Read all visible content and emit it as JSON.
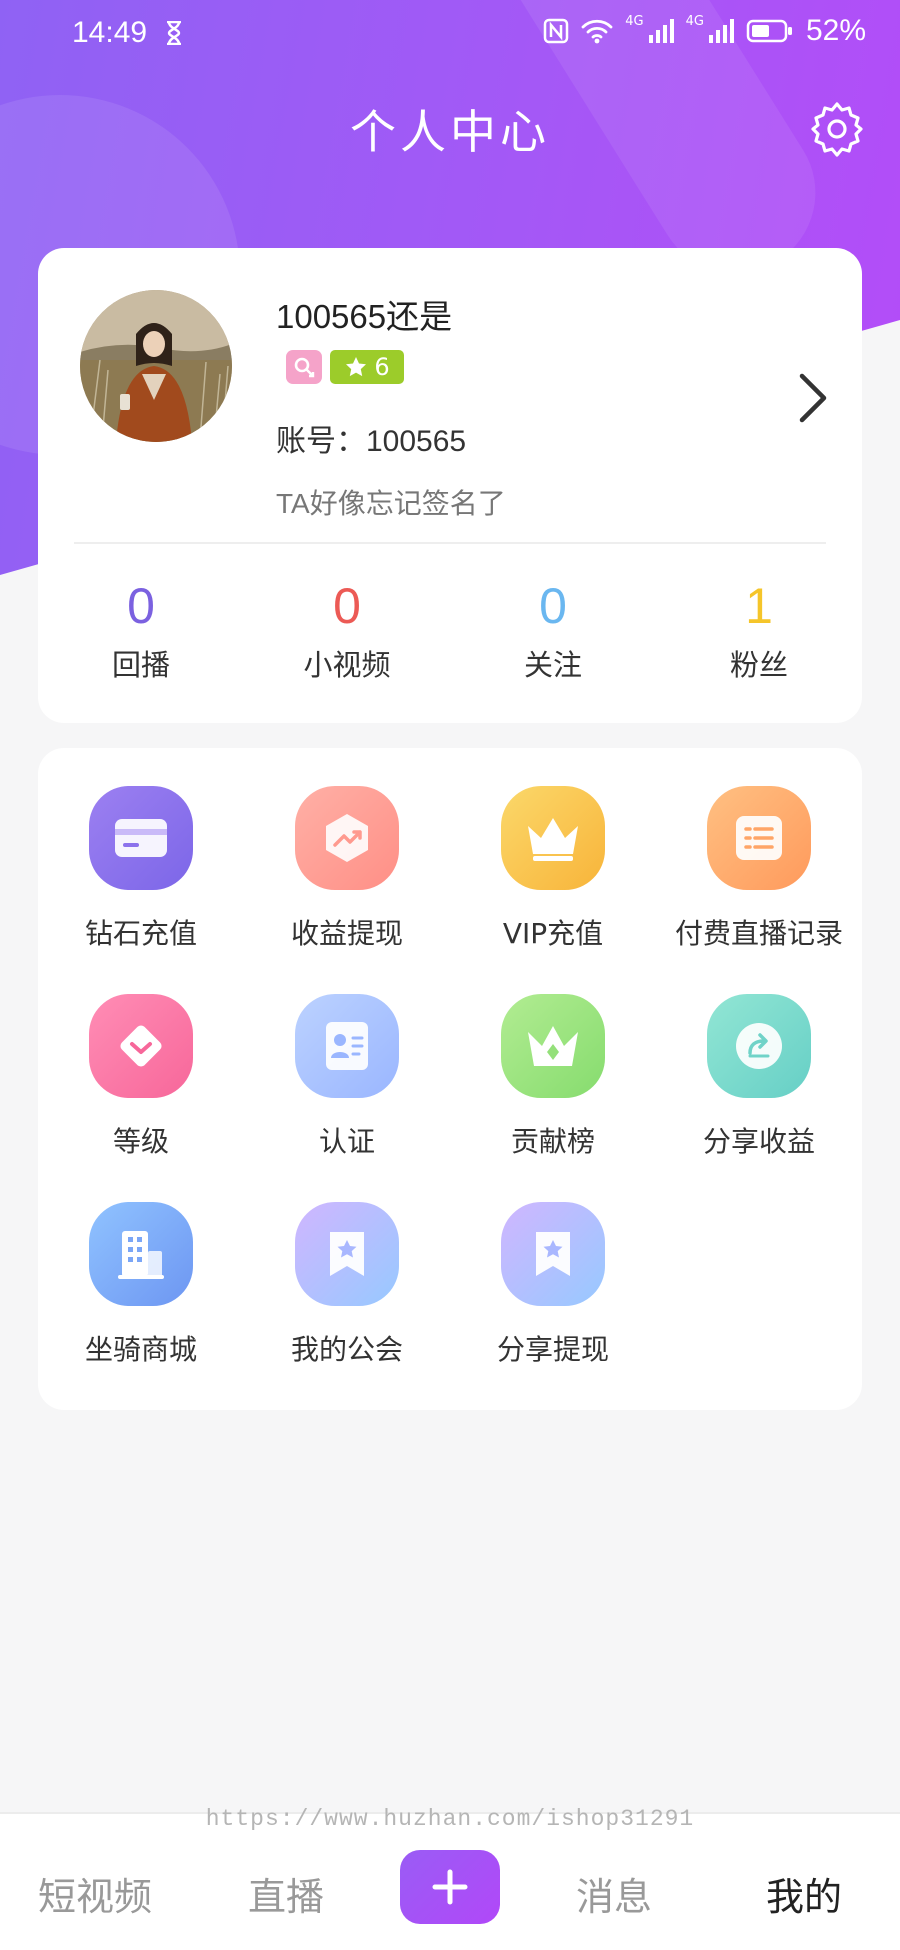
{
  "status_bar": {
    "time": "14:49",
    "battery_percent": "52%",
    "network_labels": [
      "4G",
      "4G"
    ],
    "icons": [
      "hourglass-icon",
      "nfc-icon",
      "wifi-icon",
      "signal-icon",
      "battery-icon"
    ]
  },
  "header": {
    "title": "个人中心",
    "settings_icon": "gear-icon"
  },
  "profile": {
    "username": "100565还是",
    "level": "6",
    "account_label": "账号：",
    "account_id": "100565",
    "signature": "TA好像忘记签名了"
  },
  "stats": [
    {
      "value": "0",
      "label": "回播",
      "color": "#7b61e0"
    },
    {
      "value": "0",
      "label": "小视频",
      "color": "#ec5a55"
    },
    {
      "value": "0",
      "label": "关注",
      "color": "#6ab7f0"
    },
    {
      "value": "1",
      "label": "粉丝",
      "color": "#f5c52a"
    }
  ],
  "menu": [
    {
      "label": "钻石充值",
      "icon": "card-icon",
      "colors": [
        "#9c80f1",
        "#7c66e8"
      ]
    },
    {
      "label": "收益提现",
      "icon": "chart-up-icon",
      "colors": [
        "#ffb0a6",
        "#ff8f86"
      ]
    },
    {
      "label": "VIP充值",
      "icon": "crown-icon",
      "colors": [
        "#fbd86a",
        "#f8b43a"
      ]
    },
    {
      "label": "付费直播记录",
      "icon": "list-icon",
      "colors": [
        "#ffc082",
        "#ff9a5c"
      ]
    },
    {
      "label": "等级",
      "icon": "level-icon",
      "colors": [
        "#ff8db5",
        "#f7679a"
      ]
    },
    {
      "label": "认证",
      "icon": "id-card-icon",
      "colors": [
        "#bcd2ff",
        "#9ab6ff"
      ]
    },
    {
      "label": "贡献榜",
      "icon": "crown-rank-icon",
      "colors": [
        "#b2ec92",
        "#86dc6e"
      ]
    },
    {
      "label": "分享收益",
      "icon": "share-icon",
      "colors": [
        "#92e6d4",
        "#66cfc6"
      ]
    },
    {
      "label": "坐骑商城",
      "icon": "building-icon",
      "colors": [
        "#90c3ff",
        "#6d96f2"
      ]
    },
    {
      "label": "我的公会",
      "icon": "bookmark-star-icon",
      "colors": [
        "#d0b6ff",
        "#97c9ff"
      ]
    },
    {
      "label": "分享提现",
      "icon": "bookmark-star-icon",
      "colors": [
        "#d0b6ff",
        "#97c9ff"
      ]
    }
  ],
  "watermark": "https://www.huzhan.com/ishop31291",
  "tabbar": {
    "short_video": "短视频",
    "live": "直播",
    "messages": "消息",
    "mine": "我的"
  }
}
